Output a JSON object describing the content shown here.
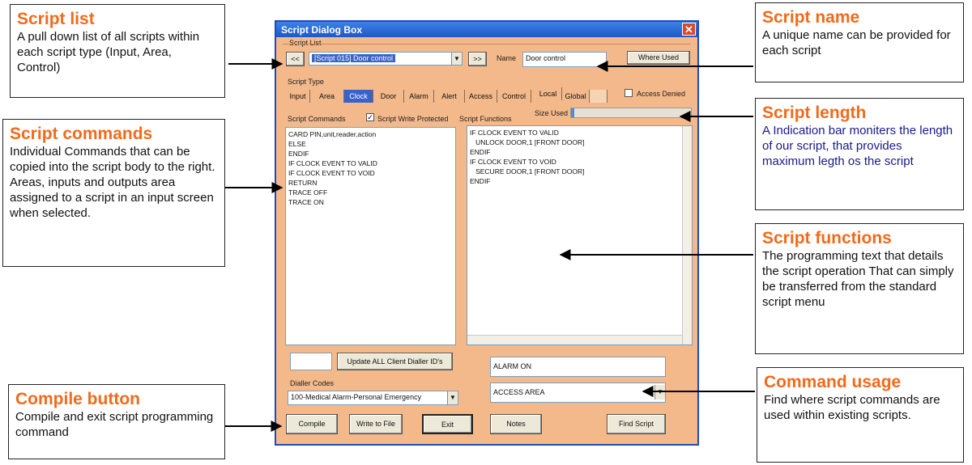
{
  "callouts": {
    "script_list": {
      "title": "Script list",
      "body": "A pull down list of all scripts within each script type (Input, Area, Control)"
    },
    "script_commands": {
      "title": "Script commands",
      "body": "Individual Commands that can be copied into the script body to the right.  Areas, inputs and outputs area assigned to a script in an input screen when selected."
    },
    "compile_button": {
      "title": "Compile button",
      "body": "Compile and exit script programming command"
    },
    "script_name": {
      "title": "Script name",
      "body": "A unique name can be provided for each script"
    },
    "script_length": {
      "title": "Script length",
      "body": "A Indication bar moniters the length of our script, that provides maximum legth os the script"
    },
    "script_functions": {
      "title": "Script functions",
      "body": "The programming text that details the script operation That can simply be transferred from the standard script menu"
    },
    "command_usage": {
      "title": "Command usage",
      "body": "Find where script commands are used within existing scripts."
    }
  },
  "dialog": {
    "title": "Script Dialog Box",
    "close_glyph": "✕",
    "script_list_label": "Script List",
    "prev_button": "<<",
    "next_button": ">>",
    "selected_script": "[Script 015] Door control",
    "name_label": "Name",
    "name_value": "Door control",
    "where_used_button": "Where Used",
    "script_type_label": "Script Type",
    "tabs": [
      "Input",
      "Area",
      "Clock",
      "Door",
      "Alarm",
      "Alert",
      "Access",
      "Control",
      "Local",
      "Global"
    ],
    "active_tab": "Clock",
    "access_denied_label": "Access Denied",
    "access_denied_checked": false,
    "script_commands_label": "Script Commands",
    "write_protected_label": "Script Write Protected",
    "write_protected_checked": true,
    "check_glyph": "✓",
    "script_functions_label": "Script Functions",
    "size_used_label": "Size Used",
    "size_used_fraction": 0.03,
    "commands": [
      "CARD PIN,unit,reader,action",
      "ELSE",
      "ENDIF",
      "IF CLOCK EVENT TO VALID",
      "IF CLOCK EVENT TO VOID",
      "RETURN",
      "TRACE OFF",
      "TRACE ON"
    ],
    "functions": [
      "IF CLOCK EVENT TO VALID",
      "   UNLOCK DOOR,1 [FRONT DOOR]",
      "ENDIF",
      "IF CLOCK EVENT TO VOID",
      "   SECURE DOOR,1 [FRONT DOOR]",
      "ENDIF"
    ],
    "update_button": "Update ALL Client Dialler ID's",
    "dialler_codes_label": "Dialler Codes",
    "dialler_selected": "100-Medical Alarm-Personal Emergency",
    "alarm_field": "ALARM ON",
    "access_field": "ACCESS AREA",
    "compile_button": "Compile",
    "write_file_button": "Write to File",
    "exit_button": "Exit",
    "notes_button": "Notes",
    "find_script_button": "Find Script",
    "dropdown_glyph": "▼"
  },
  "colors": {
    "accent_title": "#f26a1b",
    "dialog_bg": "#f3b98a",
    "active_tab": "#3a62c9",
    "length_bar": "#5b86d6"
  }
}
